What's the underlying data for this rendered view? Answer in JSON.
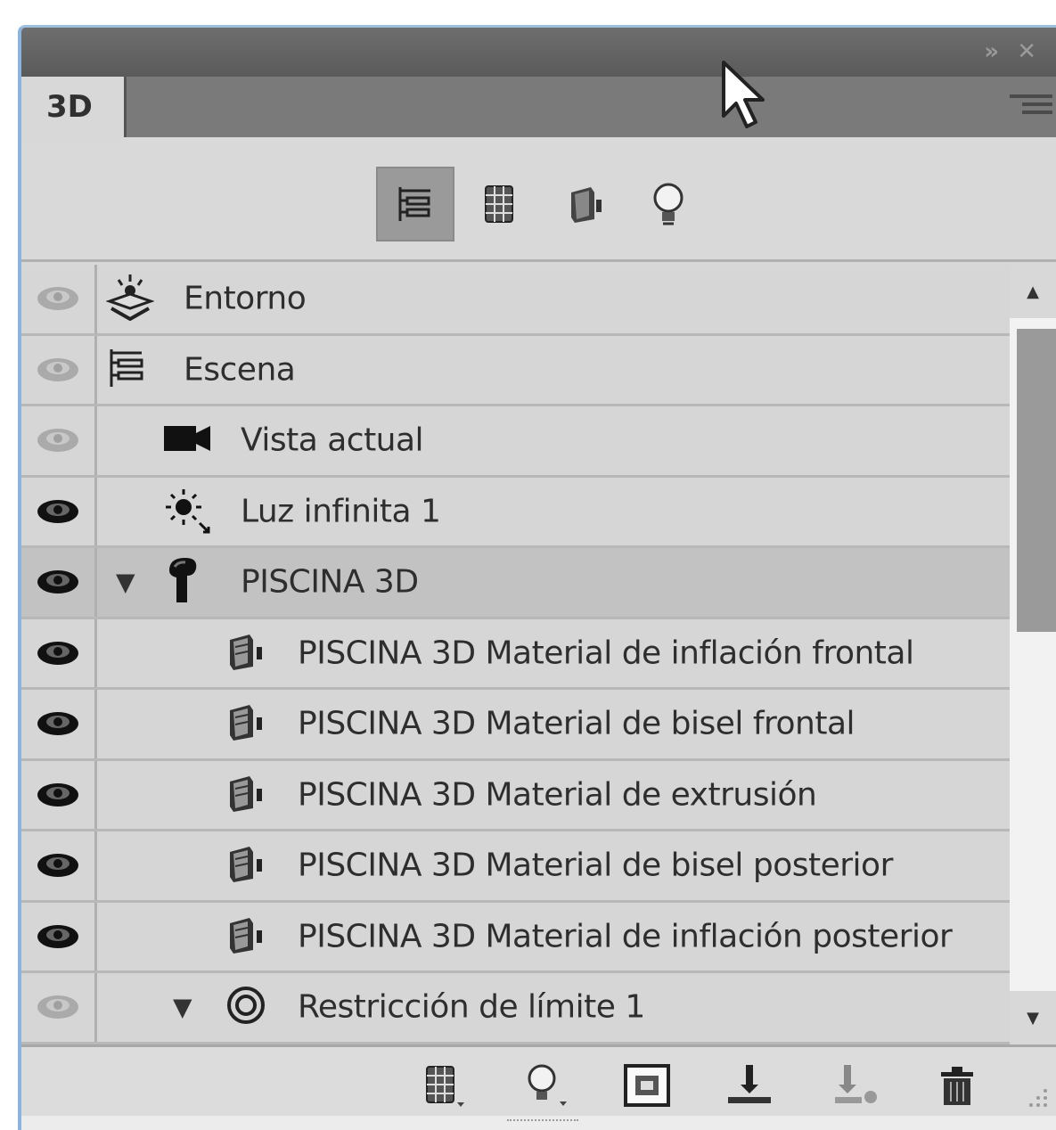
{
  "panel": {
    "tab_label": "3D",
    "filter_buttons": [
      {
        "name": "scene-filter",
        "icon": "scene-hierarchy-icon",
        "active": true
      },
      {
        "name": "meshes-filter",
        "icon": "mesh-grid-icon",
        "active": false
      },
      {
        "name": "materials-filter",
        "icon": "material-icon",
        "active": false
      },
      {
        "name": "lights-filter",
        "icon": "lightbulb-icon",
        "active": false
      }
    ]
  },
  "layers": [
    {
      "label": "Entorno",
      "icon": "environment-icon",
      "eye": "dim",
      "indent": 0,
      "expander": false,
      "selected": false
    },
    {
      "label": "Escena",
      "icon": "scene-hierarchy-icon",
      "eye": "dim",
      "indent": 0,
      "expander": false,
      "selected": false
    },
    {
      "label": "Vista actual",
      "icon": "camera-icon",
      "eye": "dim",
      "indent": 1,
      "expander": false,
      "selected": false
    },
    {
      "label": "Luz infinita 1",
      "icon": "sun-light-icon",
      "eye": "on",
      "indent": 1,
      "expander": false,
      "selected": false
    },
    {
      "label": "PISCINA 3D",
      "icon": "mesh-icon",
      "eye": "on",
      "indent": 1,
      "expander": true,
      "selected": true
    },
    {
      "label": "PISCINA 3D Material de inflación frontal",
      "icon": "material-icon",
      "eye": "on",
      "indent": 2,
      "expander": false,
      "selected": false
    },
    {
      "label": "PISCINA 3D Material de bisel frontal",
      "icon": "material-icon",
      "eye": "on",
      "indent": 2,
      "expander": false,
      "selected": false
    },
    {
      "label": "PISCINA 3D Material de extrusión",
      "icon": "material-icon",
      "eye": "on",
      "indent": 2,
      "expander": false,
      "selected": false
    },
    {
      "label": "PISCINA 3D Material de bisel posterior",
      "icon": "material-icon",
      "eye": "on",
      "indent": 2,
      "expander": false,
      "selected": false
    },
    {
      "label": "PISCINA 3D Material de inflación posterior",
      "icon": "material-icon",
      "eye": "on",
      "indent": 2,
      "expander": false,
      "selected": false
    },
    {
      "label": "Restricción de límite 1",
      "icon": "constraint-icon",
      "eye": "dim",
      "indent": 2,
      "expander": true,
      "selected": false
    }
  ],
  "bottom_buttons": [
    {
      "name": "new-mesh-button",
      "icon": "mesh-grid-icon"
    },
    {
      "name": "new-light-button",
      "icon": "lightbulb-icon"
    },
    {
      "name": "render-button",
      "icon": "render-icon"
    },
    {
      "name": "drop-to-ground-button",
      "icon": "ground-plane-icon"
    },
    {
      "name": "drop-object-button",
      "icon": "ground-object-icon"
    },
    {
      "name": "delete-button",
      "icon": "trash-icon"
    }
  ]
}
